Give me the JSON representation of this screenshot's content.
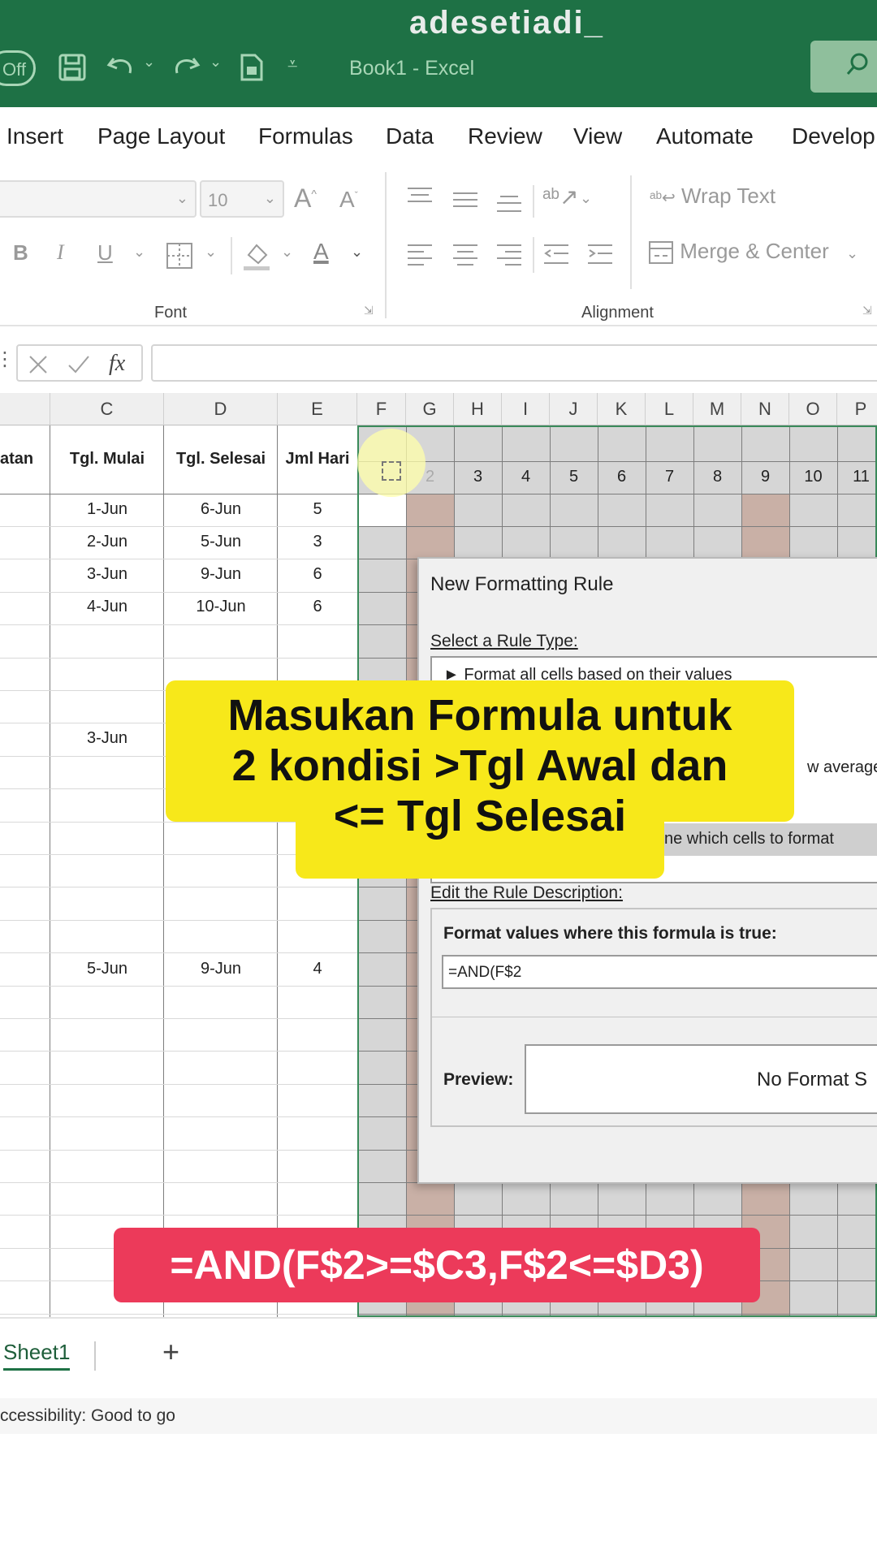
{
  "window": {
    "watermark": "adesetiadi_",
    "autosave_label": "Off",
    "title": "Book1  -  Excel",
    "search_icon": "search-icon"
  },
  "menu": {
    "tabs": [
      "Insert",
      "Page Layout",
      "Formulas",
      "Data",
      "Review",
      "View",
      "Automate",
      "Develop"
    ]
  },
  "ribbon": {
    "font_size": "10",
    "wrap_text": "Wrap Text",
    "merge_center": "Merge & Center",
    "bold": "B",
    "italic": "I",
    "underline": "U",
    "font_group_label": "Font",
    "alignment_group_label": "Alignment"
  },
  "formula_bar": {
    "fx": "fx"
  },
  "grid": {
    "column_headers": [
      "C",
      "D",
      "E",
      "F",
      "G",
      "H",
      "I",
      "J",
      "K",
      "L",
      "M",
      "N",
      "O",
      "P"
    ],
    "table_headers": {
      "activity_partial": "atan",
      "start": "Tgl. Mulai",
      "end": "Tgl. Selesai",
      "days": "Jml Hari"
    },
    "day_numbers": [
      "2",
      "3",
      "4",
      "5",
      "6",
      "7",
      "8",
      "9",
      "10",
      "11"
    ],
    "rows": [
      {
        "start": "1-Jun",
        "end": "6-Jun",
        "days": "5"
      },
      {
        "start": "2-Jun",
        "end": "5-Jun",
        "days": "3"
      },
      {
        "start": "3-Jun",
        "end": "9-Jun",
        "days": "6"
      },
      {
        "start": "4-Jun",
        "end": "10-Jun",
        "days": "6"
      },
      {
        "start": "3-Jun",
        "end": "",
        "days": ""
      },
      {
        "start": "5-Jun",
        "end": "9-Jun",
        "days": "4"
      }
    ],
    "highlight_color": "#c9b0a6"
  },
  "dialog": {
    "title": "New Formatting Rule",
    "select_rule_type": "Select a Rule Type:",
    "rule_option_1": "► Format all cells based on their values",
    "rule_option_partial_average": "w average",
    "rule_option_selected_partial": "ne which cells to format",
    "edit_rule_description": "Edit the Rule Description:",
    "format_values_label": "Format values where this formula is true:",
    "formula_value": "=AND(F$2",
    "preview_label": "Preview:",
    "preview_text": "No Format S"
  },
  "overlays": {
    "caption": "Masukan Formula untuk\n2 kondisi >Tgl Awal dan\n<= Tgl Selesai",
    "formula_caption": "=AND(F$2>=$C3,F$2<=$D3)",
    "caption_bg": "#f7e81a",
    "formula_bg": "#ec3a5a"
  },
  "sheets": {
    "active": "Sheet1",
    "add": "+"
  },
  "status": {
    "text": "ccessibility: Good to go"
  }
}
